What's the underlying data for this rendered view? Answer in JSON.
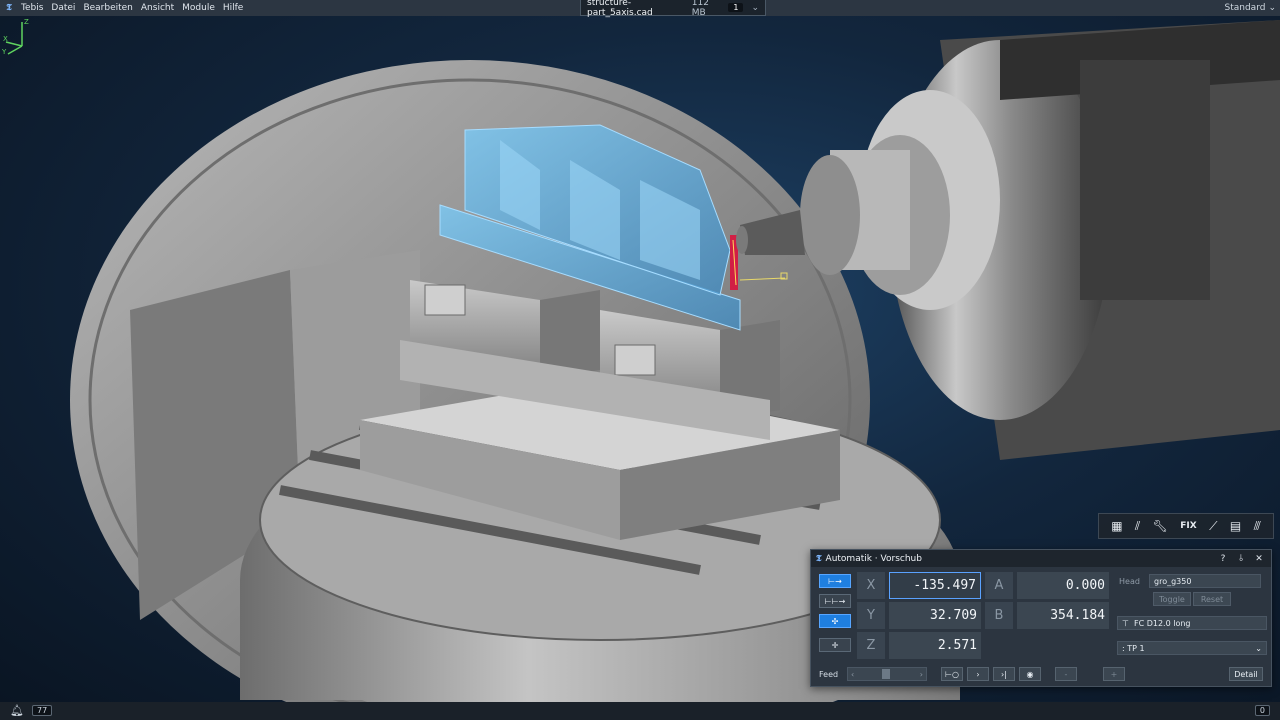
{
  "app": {
    "logo": "Tebis",
    "menu": [
      "Tebis",
      "Datei",
      "Bearbeiten",
      "Ansicht",
      "Module",
      "Hilfe"
    ],
    "file_tab": {
      "name": "structure-part_5axis.cad",
      "size": "112 MB",
      "count": "1"
    },
    "workspace": "Standard"
  },
  "toolbar": {
    "items": [
      {
        "name": "nc-program-icon"
      },
      {
        "name": "toolpath-icon"
      },
      {
        "name": "wrench-icon"
      },
      {
        "name": "fix-label",
        "label": "FIX"
      },
      {
        "name": "tool-holder-icon"
      },
      {
        "name": "machine-icon"
      },
      {
        "name": "milling-tool-icon"
      }
    ]
  },
  "dialog": {
    "title": "Automatik · Vorschub",
    "help": "?",
    "pin": "⫰",
    "close": "✕",
    "axes": [
      {
        "label": "X",
        "value": "-135.497"
      },
      {
        "label": "Y",
        "value": "32.709"
      },
      {
        "label": "Z",
        "value": "2.571"
      },
      {
        "label": "A",
        "value": "0.000"
      },
      {
        "label": "B",
        "value": "354.184"
      }
    ],
    "head_label": "Head",
    "head_value": "gro_g350",
    "toggle": "Toggle",
    "reset": "Reset",
    "tool": "FC D12.0 long",
    "tp": ": TP 1",
    "feed_label": "Feed",
    "detail": "Detail",
    "minus": "-",
    "plus": "+"
  },
  "status": {
    "left_count": "77",
    "right_count": "0"
  },
  "colors": {
    "accent": "#1f7fe0",
    "part": "#5fb4e6"
  }
}
